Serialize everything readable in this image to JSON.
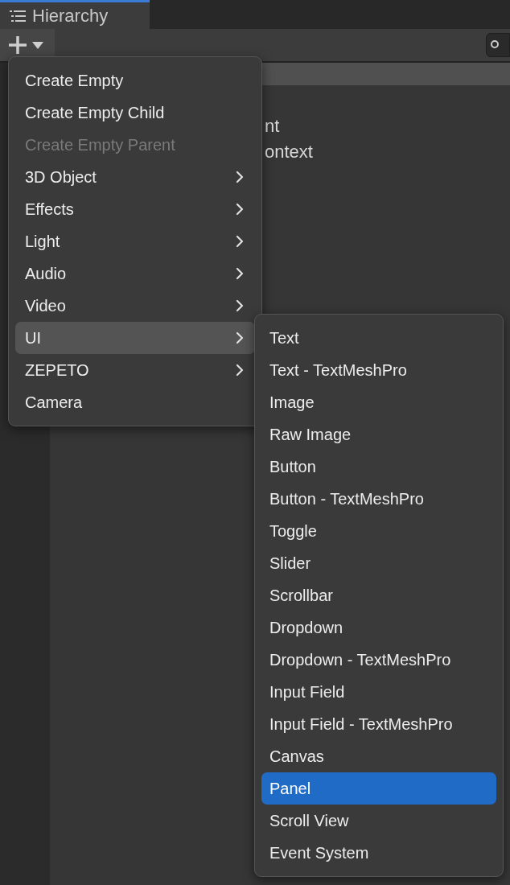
{
  "window": {
    "tab": {
      "label": "Hierarchy",
      "selected": true
    }
  },
  "background_texts": [
    "nt",
    "ontext"
  ],
  "menu": {
    "items": [
      {
        "label": "Create Empty",
        "disabled": false,
        "submenu": false,
        "selected": false
      },
      {
        "label": "Create Empty Child",
        "disabled": false,
        "submenu": false,
        "selected": false
      },
      {
        "label": "Create Empty Parent",
        "disabled": true,
        "submenu": false,
        "selected": false
      },
      {
        "label": "3D Object",
        "disabled": false,
        "submenu": true,
        "selected": false
      },
      {
        "label": "Effects",
        "disabled": false,
        "submenu": true,
        "selected": false
      },
      {
        "label": "Light",
        "disabled": false,
        "submenu": true,
        "selected": false
      },
      {
        "label": "Audio",
        "disabled": false,
        "submenu": true,
        "selected": false
      },
      {
        "label": "Video",
        "disabled": false,
        "submenu": true,
        "selected": false
      },
      {
        "label": "UI",
        "disabled": false,
        "submenu": true,
        "selected": true
      },
      {
        "label": "ZEPETO",
        "disabled": false,
        "submenu": true,
        "selected": false
      },
      {
        "label": "Camera",
        "disabled": false,
        "submenu": false,
        "selected": false
      }
    ]
  },
  "submenu": {
    "items": [
      {
        "label": "Text",
        "selected": false
      },
      {
        "label": "Text - TextMeshPro",
        "selected": false
      },
      {
        "label": "Image",
        "selected": false
      },
      {
        "label": "Raw Image",
        "selected": false
      },
      {
        "label": "Button",
        "selected": false
      },
      {
        "label": "Button - TextMeshPro",
        "selected": false
      },
      {
        "label": "Toggle",
        "selected": false
      },
      {
        "label": "Slider",
        "selected": false
      },
      {
        "label": "Scrollbar",
        "selected": false
      },
      {
        "label": "Dropdown",
        "selected": false
      },
      {
        "label": "Dropdown - TextMeshPro",
        "selected": false
      },
      {
        "label": "Input Field",
        "selected": false
      },
      {
        "label": "Input Field - TextMeshPro",
        "selected": false
      },
      {
        "label": "Canvas",
        "selected": false
      },
      {
        "label": "Panel",
        "selected": true
      },
      {
        "label": "Scroll View",
        "selected": false
      },
      {
        "label": "Event System",
        "selected": false
      }
    ]
  }
}
